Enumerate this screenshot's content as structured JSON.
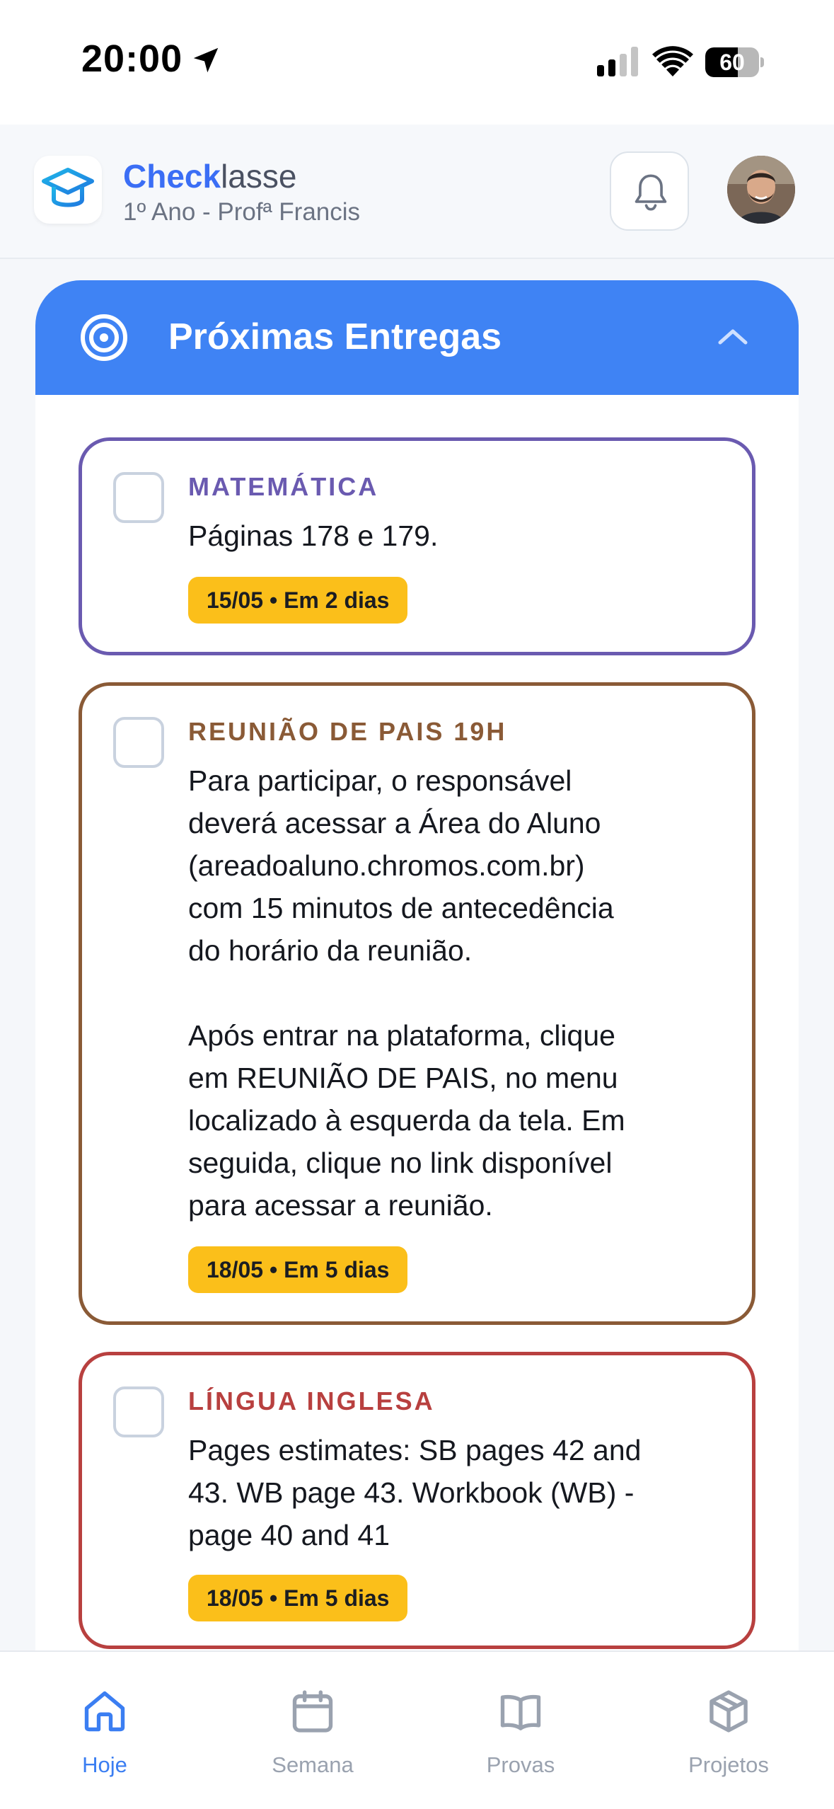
{
  "status_bar": {
    "time": "20:00",
    "battery": "60",
    "battery_level": 0.6
  },
  "header": {
    "brand_strong": "Check",
    "brand_light": "lasse",
    "subtitle": "1º Ano - Profª Francis"
  },
  "section": {
    "title": "Próximas Entregas"
  },
  "tasks": [
    {
      "subject": "MATEMÁTICA",
      "description": "Páginas 178 e 179.",
      "due": "15/05 • Em 2 dias",
      "color": "#6a5ab0"
    },
    {
      "subject": "REUNIÃO DE PAIS 19H",
      "description": "Para participar, o responsável\ndeverá acessar a Área do Aluno\n(areadoaluno.chromos.com.br)\ncom 15 minutos de antecedência\ndo horário da reunião.\n\nApós entrar na plataforma, clique\nem REUNIÃO DE PAIS, no menu\nlocalizado à esquerda da tela. Em\nseguida, clique no link disponível\npara acessar a reunião.",
      "due": "18/05 • Em 5 dias",
      "color": "#8a5a36"
    },
    {
      "subject": "LÍNGUA INGLESA",
      "description": "Pages estimates: SB pages 42 and\n43. WB page 43. Workbook (WB) -\npage 40 and 41",
      "due": "18/05 • Em 5 dias",
      "color": "#b8403f"
    }
  ],
  "nav": [
    {
      "label": "Hoje",
      "icon": "home-icon",
      "active": true
    },
    {
      "label": "Semana",
      "icon": "calendar-icon",
      "active": false
    },
    {
      "label": "Provas",
      "icon": "book-icon",
      "active": false
    },
    {
      "label": "Projetos",
      "icon": "box-icon",
      "active": false
    }
  ],
  "colors": {
    "accent": "#3f83f4",
    "badge": "#fbbf1a",
    "nav_active": "#3b7ef2"
  }
}
